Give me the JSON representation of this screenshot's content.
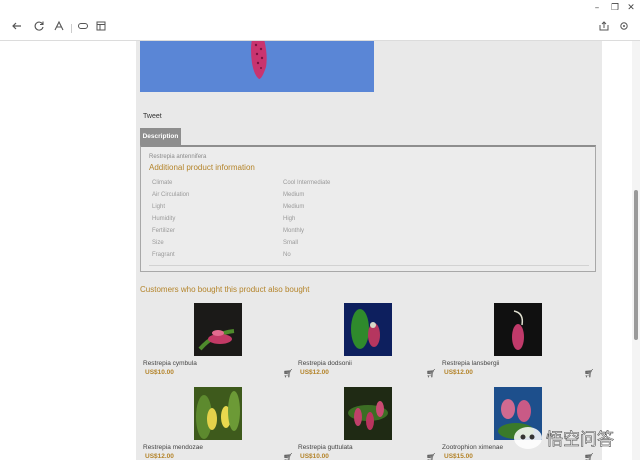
{
  "browser": {
    "toolbar": {
      "back_icon": "back-arrow-icon",
      "refresh_icon": "refresh-icon",
      "reader_icon": "text-size-icon",
      "voice_icon": "read-aloud-icon",
      "reading_view_icon": "reading-view-icon",
      "share_icon": "share-icon",
      "settings_icon": "settings-icon"
    },
    "window": {
      "minimize": "–",
      "maximize": "❐",
      "close": "✕"
    }
  },
  "page": {
    "tweet_label": "Tweet",
    "tab_description": "Description",
    "product": {
      "name": "Restrepia antennifera",
      "info_title": "Additional product information",
      "attributes": [
        {
          "key": "Climate",
          "value": "Cool Intermediate"
        },
        {
          "key": "Air Circulation",
          "value": "Medium"
        },
        {
          "key": "Light",
          "value": "Medium"
        },
        {
          "key": "Humidity",
          "value": "High"
        },
        {
          "key": "Fertilizer",
          "value": "Monthly"
        },
        {
          "key": "Size",
          "value": "Small"
        },
        {
          "key": "Fragrant",
          "value": "No"
        }
      ]
    },
    "also_bought_title": "Customers who bought this product also bought",
    "related": [
      {
        "name": "Restrepia cymbula",
        "price": "US$10.00"
      },
      {
        "name": "Restrepia dodsonii",
        "price": "US$12.00"
      },
      {
        "name": "Restrepia lansbergii",
        "price": "US$12.00"
      },
      {
        "name": "Restrepia mendozae",
        "price": "US$12.00"
      },
      {
        "name": "Restrepia guttulata",
        "price": "US$10.00"
      },
      {
        "name": "Zootrophion ximenae",
        "price": "US$15.00"
      }
    ]
  },
  "watermark": {
    "text": "悟空问答"
  },
  "colors": {
    "accent": "#b4842a",
    "tab": "#8e8e8e",
    "content_bg": "#e9e9e9"
  }
}
